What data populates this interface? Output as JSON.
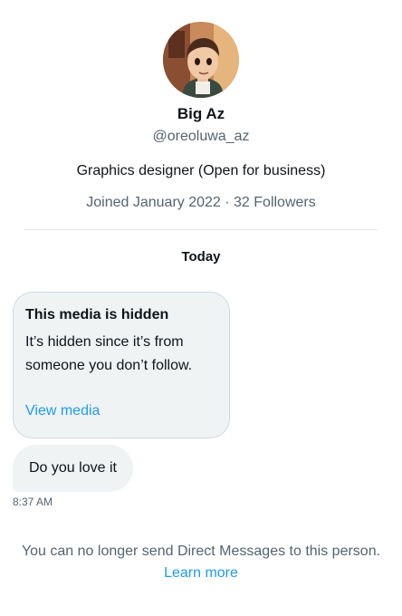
{
  "profile": {
    "avatar_icon": "profile-avatar",
    "display_name": "Big Az",
    "handle": "@oreoluwa_az",
    "bio": "Graphics designer (Open for business)",
    "meta": "Joined January 2022 · 32 Followers"
  },
  "conversation": {
    "date_separator": "Today",
    "hidden_media": {
      "title": "This media is hidden",
      "description": "It’s hidden since it’s from someone you don’t follow.",
      "link_label": "View media"
    },
    "message": {
      "text": "Do you love it",
      "time": "8:37 AM"
    }
  },
  "footer": {
    "notice": "You can no longer send Direct Messages to this person.",
    "link_label": "Learn more"
  },
  "colors": {
    "accent": "#1d9bf0",
    "secondary_text": "#536471",
    "bubble": "#eff3f4"
  }
}
